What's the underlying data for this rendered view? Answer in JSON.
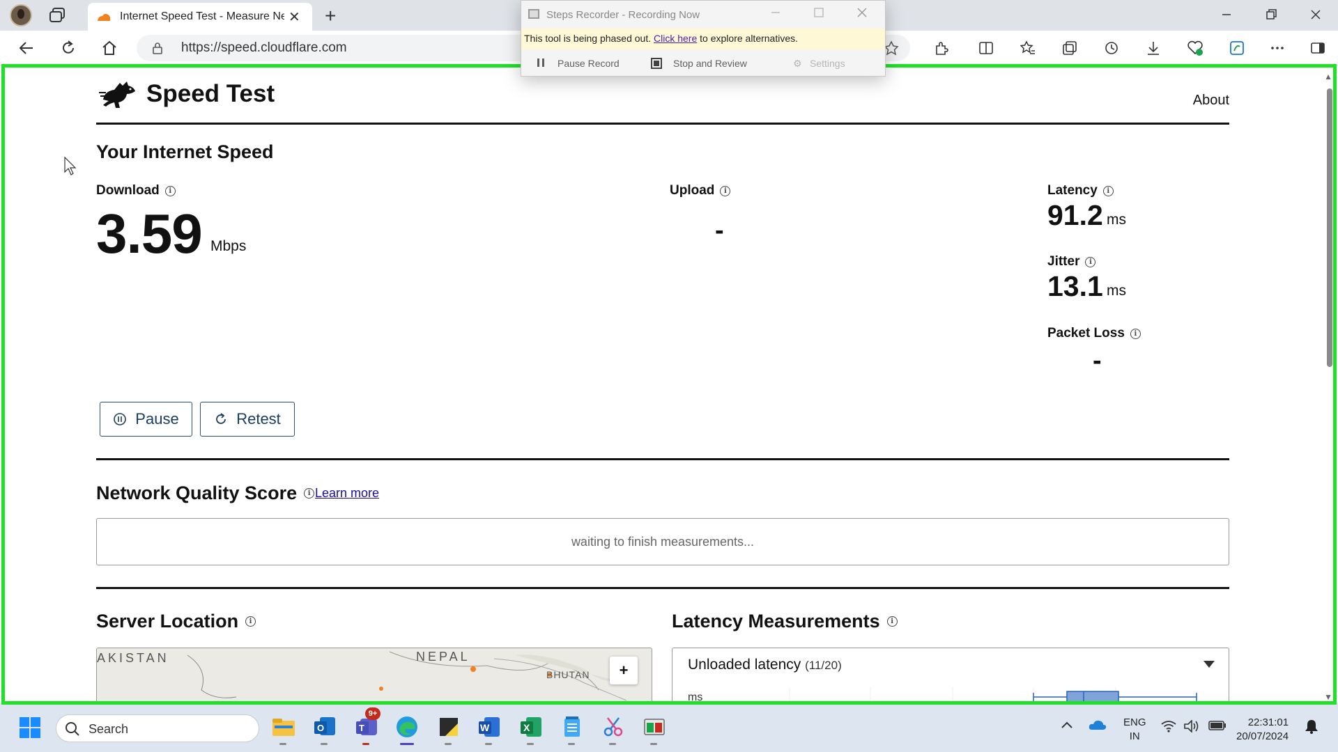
{
  "browser": {
    "tab": {
      "title": "Internet Speed Test - Measure Network Performance | Cloudflare",
      "close": "✕"
    },
    "new_tab": "+",
    "address": {
      "url": "https://speed.cloudflare.com"
    }
  },
  "steps_recorder": {
    "title": "Steps Recorder - Recording Now",
    "banner_text": "This tool is being phased out.",
    "banner_link": "Click here",
    "banner_suffix": "to explore alternatives.",
    "tools": [
      "Pause Record",
      "Stop and Review",
      "Settings"
    ]
  },
  "page": {
    "site_title": "Speed Test",
    "about": "About",
    "speed_heading": "Your Internet Speed",
    "download": {
      "label": "Download",
      "value": "3.59",
      "unit": "Mbps"
    },
    "upload": {
      "label": "Upload",
      "value": "-"
    },
    "latency": {
      "label": "Latency",
      "value": "91.2",
      "unit": "ms"
    },
    "jitter": {
      "label": "Jitter",
      "value": "13.1",
      "unit": "ms"
    },
    "packet_loss": {
      "label": "Packet Loss",
      "value": "-"
    },
    "buttons": {
      "pause": "Pause",
      "retest": "Retest"
    },
    "network_quality": {
      "heading": "Network Quality Score",
      "learn_more": "Learn more",
      "status": "waiting to finish measurements..."
    },
    "server_location": {
      "heading": "Server Location",
      "map_labels": [
        "AKISTAN",
        "NEPAL",
        "BHUTAN"
      ],
      "zoom_in": "+"
    },
    "latency_measurements": {
      "heading": "Latency Measurements",
      "panel_title": "Unloaded latency",
      "panel_count": "(11/20)",
      "axis_unit": "ms"
    }
  },
  "taskbar": {
    "search_placeholder": "Search",
    "teams_badge": "9+",
    "language": {
      "line1": "ENG",
      "line2": "IN"
    },
    "time": "22:31:01",
    "date": "20/07/2024"
  },
  "colors": {
    "recording_frame": "#22e02a",
    "button_border": "#2a4f7c",
    "link": "#1a0dab",
    "cloudflare_orange": "#f48120"
  }
}
